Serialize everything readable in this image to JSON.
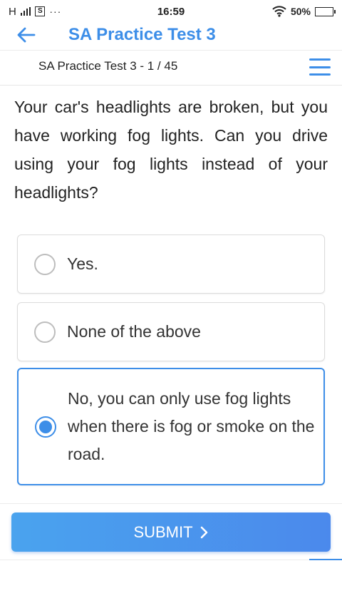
{
  "status_bar": {
    "network": "H",
    "sim_label": "S",
    "dots": "···",
    "time": "16:59",
    "battery": "50%",
    "battery_level": 0.5
  },
  "app_bar": {
    "title": "SA Practice Test 3",
    "back_icon": "arrow-left-icon"
  },
  "sub_bar": {
    "title": "SA Practice Test 3 - 1 / 45",
    "menu_icon": "hamburger-menu-icon"
  },
  "question": {
    "text": "Your car's headlights are broken, but you have working fog lights. Can you drive using your fog lights instead of your headlights?"
  },
  "options": [
    {
      "label": "Yes.",
      "selected": false
    },
    {
      "label": "None of the above",
      "selected": false
    },
    {
      "label": "No, you can only use fog lights when there is fog or smoke on the road.",
      "selected": true
    }
  ],
  "submit": {
    "label": "SUBMIT",
    "icon": "chevron-right-icon"
  },
  "colors": {
    "accent": "#3d8ee8",
    "button_gradient_start": "#4aa3ee",
    "button_gradient_end": "#4b89ec"
  }
}
